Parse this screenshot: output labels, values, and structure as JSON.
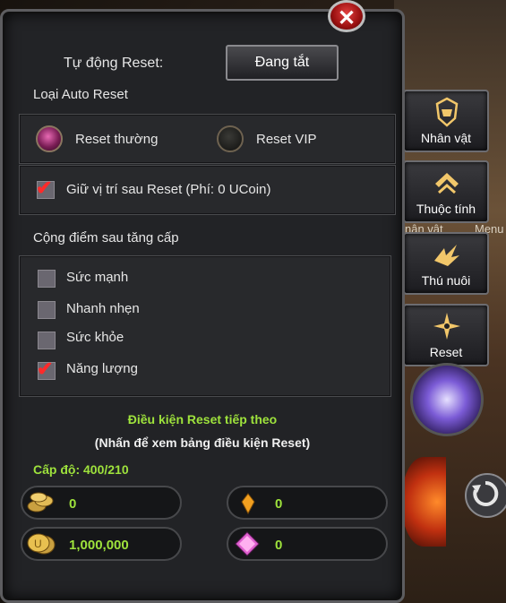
{
  "panel": {
    "auto_reset_label": "Tự động Reset:",
    "toggle_button": "Đang tắt",
    "reset_type_label": "Loại Auto Reset",
    "radio_normal": "Reset thường",
    "radio_vip": "Reset VIP",
    "keep_position": "Giữ vị trí sau Reset (Phí: 0 UCoin)",
    "stats_label": "Cộng điểm sau tăng cấp",
    "stats": [
      {
        "label": "Sức mạnh",
        "checked": false
      },
      {
        "label": "Nhanh nhẹn",
        "checked": false
      },
      {
        "label": "Sức khỏe",
        "checked": false
      },
      {
        "label": "Năng lượng",
        "checked": true
      }
    ],
    "condition_title": "Điều kiện Reset tiếp theo",
    "condition_hint": "(Nhấn để xem bảng điều kiện Reset)",
    "level": "Cấp độ: 400/210",
    "resources": {
      "gold_coins": "0",
      "crystal": "0",
      "zen": "1,000,000",
      "gem": "0"
    }
  },
  "side_menu": [
    "Nhân vật",
    "Thuộc tính",
    "Thú nuôi",
    "Reset"
  ],
  "background_text": {
    "fragment1": "nân vật",
    "fragment2": "Menu"
  },
  "colors": {
    "accent_green": "#9ee23c",
    "check_red": "#ff2a2a",
    "panel_bg": "#222326"
  }
}
